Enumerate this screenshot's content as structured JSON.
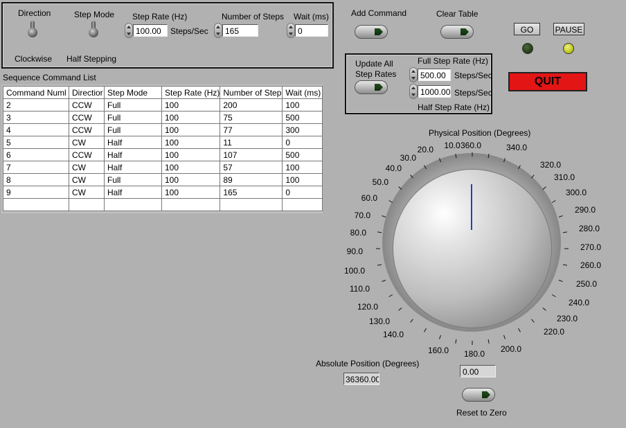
{
  "config_panel": {
    "direction_label": "Direction",
    "direction_value": "Clockwise",
    "step_mode_label": "Step Mode",
    "step_mode_value": "Half Stepping",
    "step_rate_label": "Step Rate (Hz)",
    "step_rate_value": "100.00",
    "step_rate_unit": "Steps/Sec",
    "num_steps_label": "Number of Steps",
    "num_steps_value": "165",
    "wait_label": "Wait (ms)",
    "wait_value": "0"
  },
  "commands": {
    "add_label": "Add Command",
    "clear_label": "Clear Table"
  },
  "run": {
    "go_label": "GO",
    "pause_label": "PAUSE",
    "go_light_color": "#1f3a14",
    "pause_light_color": "#b8c414",
    "quit_label": "QUIT"
  },
  "rates_panel": {
    "update_label": "Update All Step Rates",
    "full_label": "Full Step Rate (Hz)",
    "full_value": "500.00",
    "full_unit": "Steps/Sec",
    "half_value": "1000.00",
    "half_unit": "Steps/Sec",
    "half_label": "Half Step Rate (Hz)"
  },
  "table": {
    "title": "Sequence Command List",
    "columns": [
      "Command Numl",
      "Directior",
      "Step Mode",
      "Step Rate (Hz)",
      "Number of Step",
      "Wait (ms)"
    ],
    "rows": [
      [
        "2",
        "CCW",
        "Full",
        "100",
        "200",
        "100"
      ],
      [
        "3",
        "CCW",
        "Full",
        "100",
        "75",
        "500"
      ],
      [
        "4",
        "CCW",
        "Full",
        "100",
        "77",
        "300"
      ],
      [
        "5",
        "CW",
        "Half",
        "100",
        "11",
        "0"
      ],
      [
        "6",
        "CCW",
        "Half",
        "100",
        "107",
        "500"
      ],
      [
        "7",
        "CW",
        "Half",
        "100",
        "57",
        "100"
      ],
      [
        "8",
        "CW",
        "Full",
        "100",
        "89",
        "100"
      ],
      [
        "9",
        "CW",
        "Half",
        "100",
        "165",
        "0"
      ],
      [
        "",
        "",
        "",
        "",
        "",
        ""
      ]
    ]
  },
  "position": {
    "knob_label": "Physical Position (Degrees)",
    "knob_value_deg": 0,
    "scale_labels": [
      "360.0",
      "340.0",
      "320.0",
      "310.0",
      "300.0",
      "290.0",
      "280.0",
      "270.0",
      "260.0",
      "250.0",
      "240.0",
      "230.0",
      "220.0",
      "200.0",
      "180.0",
      "160.0",
      "140.0",
      "130.0",
      "120.0",
      "110.0",
      "100.0",
      "90.0",
      "80.0",
      "70.0",
      "60.0",
      "50.0",
      "40.0",
      "30.0",
      "20.0",
      "10.0"
    ],
    "absolute_label": "Absolute Position (Degrees)",
    "absolute_value": "36360.00",
    "readout_value": "0.00",
    "reset_label": "Reset to Zero"
  }
}
